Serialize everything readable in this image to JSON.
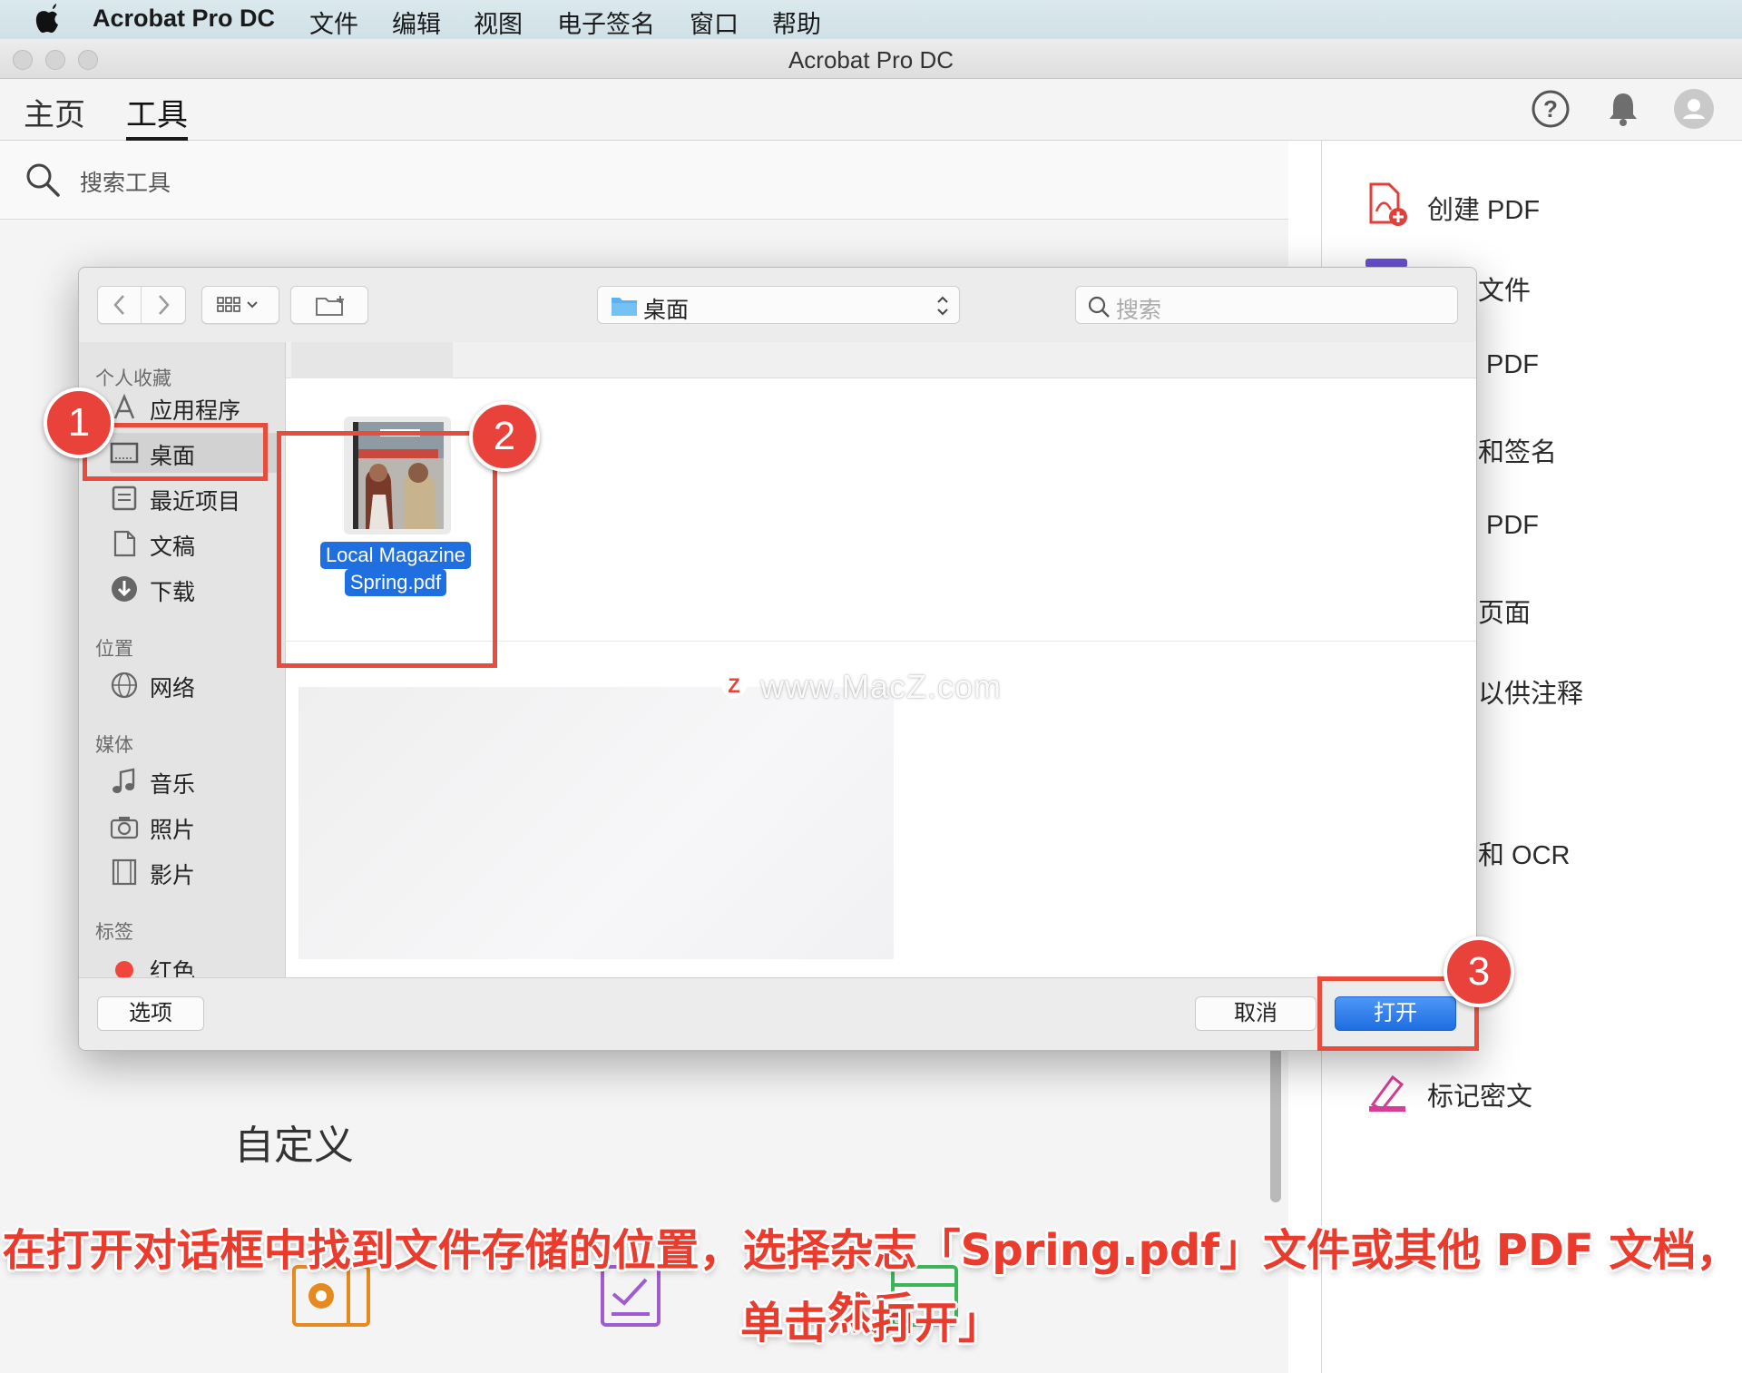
{
  "menubar": {
    "app_name": "Acrobat Pro DC",
    "items": [
      "文件",
      "编辑",
      "视图",
      "电子签名",
      "窗口",
      "帮助"
    ]
  },
  "window": {
    "title": "Acrobat Pro DC"
  },
  "tabs": [
    {
      "label": "主页",
      "active": false
    },
    {
      "label": "工具",
      "active": true
    }
  ],
  "search": {
    "placeholder": "搜索工具"
  },
  "main": {
    "section_label": "自定义"
  },
  "right_panel": {
    "items": [
      "创建 PDF",
      "文件",
      "PDF",
      "和签名",
      "PDF",
      "页面",
      "以供注释",
      "和 OCR",
      "标记密文"
    ]
  },
  "dialog": {
    "location": "桌面",
    "search_placeholder": "搜索",
    "sidebar": {
      "sections": [
        {
          "heading": "个人收藏",
          "items": [
            "应用程序",
            "桌面",
            "最近项目",
            "文稿",
            "下载"
          ]
        },
        {
          "heading": "位置",
          "items": [
            "网络"
          ]
        },
        {
          "heading": "媒体",
          "items": [
            "音乐",
            "照片",
            "影片"
          ]
        },
        {
          "heading": "标签",
          "items": [
            "红色"
          ]
        }
      ],
      "selected": "桌面"
    },
    "file": {
      "name_line1": "Local Magazine",
      "name_line2": "Spring.pdf"
    },
    "buttons": {
      "options": "选项",
      "cancel": "取消",
      "open": "打开"
    }
  },
  "annotations": {
    "badges": [
      "1",
      "2",
      "3"
    ],
    "caption_line1": "在打开对话框中找到文件存储的位置，选择杂志「Spring.pdf」文件或其他 PDF 文档，然后",
    "caption_line2": "单击「打开」",
    "watermark": "www.MacZ.com",
    "color": "#e74c3c"
  }
}
